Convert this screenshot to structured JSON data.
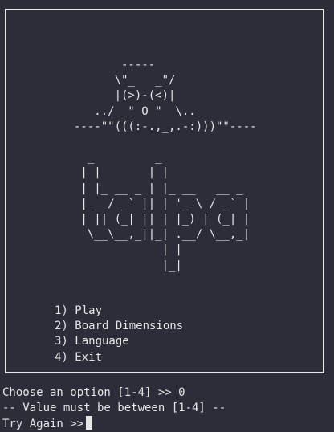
{
  "banner": {
    "art": "       -----\n      \\\"_   _\"/\n      |(>)-(<)|\n   ../  \" O \"  \\..\n----\"\"(((:-.,_,.-:)))\"\"----\n\n  _         _\n | |       | |\n | |_ __ _ | |_ __   __ _\n | __/ _` || | '_ \\ / _` |\n | || (_| || | |_) | (_| |\n  \\__\\__,_||_| .__/ \\__,_|\n             | |\n             |_|"
  },
  "menu": {
    "items": [
      {
        "label": "1) Play"
      },
      {
        "label": "2) Board Dimensions"
      },
      {
        "label": "3) Language"
      },
      {
        "label": "4) Exit"
      }
    ]
  },
  "console": {
    "lines": [
      "Choose an option [1-4] >> 0",
      "-- Value must be between [1-4] --"
    ],
    "prompt": "Try Again >>",
    "input_value": ""
  },
  "colors": {
    "background": "#2b2e38",
    "foreground": "#e6e6e6",
    "border": "#e8e8e8"
  }
}
